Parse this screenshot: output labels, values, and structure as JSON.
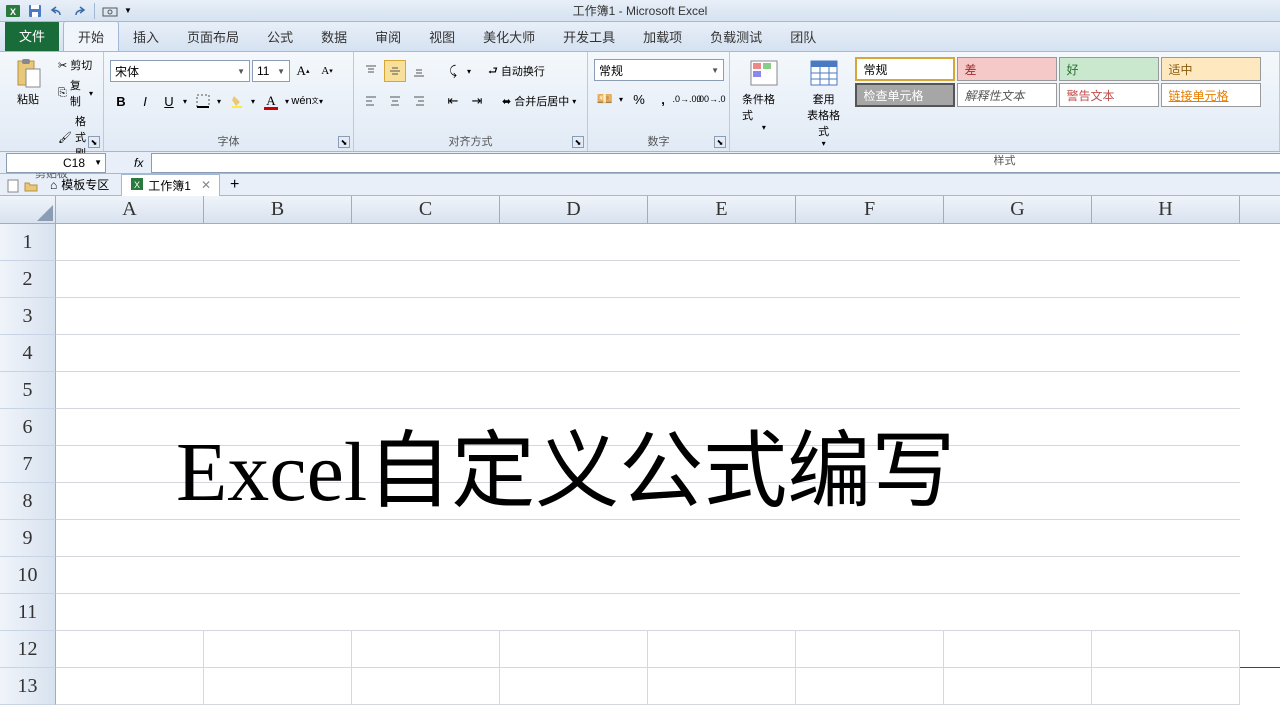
{
  "title": "工作簿1 - Microsoft Excel",
  "tabs": {
    "file": "文件",
    "list": [
      "开始",
      "插入",
      "页面布局",
      "公式",
      "数据",
      "审阅",
      "视图",
      "美化大师",
      "开发工具",
      "加载项",
      "负载测试",
      "团队"
    ]
  },
  "clipboard": {
    "paste": "粘贴",
    "cut": "剪切",
    "copy": "复制",
    "format_painter": "格式刷",
    "label": "剪贴板"
  },
  "font": {
    "name": "宋体",
    "size": "11",
    "label": "字体"
  },
  "alignment": {
    "wrap": "自动换行",
    "merge": "合并后居中",
    "label": "对齐方式"
  },
  "number": {
    "format": "常规",
    "label": "数字"
  },
  "styles_group": {
    "cond": "条件格式",
    "table": "套用\n表格格式",
    "label": "样式"
  },
  "styles": {
    "normal": "常规",
    "bad": "差",
    "good": "好",
    "neutral": "适中",
    "check": "检查单元格",
    "explain": "解释性文本",
    "warn": "警告文本",
    "link": "链接单元格"
  },
  "name_box": "C18",
  "sheet_tabs": {
    "templates": "模板专区",
    "workbook": "工作簿1"
  },
  "columns": [
    "A",
    "B",
    "C",
    "D",
    "E",
    "F",
    "G",
    "H"
  ],
  "rows": [
    "1",
    "2",
    "3",
    "4",
    "5",
    "6",
    "7",
    "8",
    "9",
    "10",
    "11",
    "12",
    "13"
  ],
  "center_text": "Excel自定义公式编写"
}
